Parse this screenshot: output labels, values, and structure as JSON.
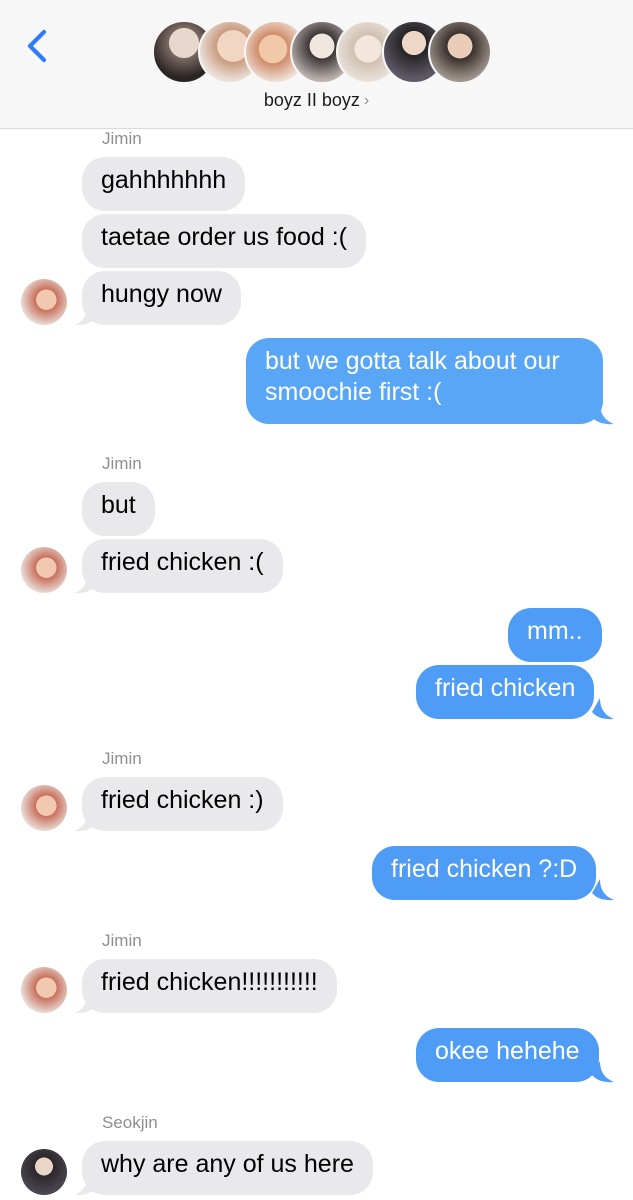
{
  "header": {
    "group_name": "boyz II boyz",
    "chevron": "›",
    "back_icon": "chevron-left-icon",
    "accent_color": "#2f7cf6",
    "member_avatar_count": 7
  },
  "colors": {
    "received_bubble": "#e9e9eb",
    "sent_bubble": "#4e9cf5",
    "sender_label": "#8e8e93"
  },
  "messages": [
    {
      "from": "Jimin",
      "direction": "received",
      "sender_label": "Jimin",
      "text": "gahhhhhhh"
    },
    {
      "from": "Jimin",
      "direction": "received",
      "text": "taetae order us food :("
    },
    {
      "from": "Jimin",
      "direction": "received",
      "text": "hungy now"
    },
    {
      "from": "me",
      "direction": "sent",
      "text_lines": [
        "but we gotta talk about our",
        "smoochie first :("
      ]
    },
    {
      "from": "Jimin",
      "direction": "received",
      "sender_label": "Jimin",
      "text": "but"
    },
    {
      "from": "Jimin",
      "direction": "received",
      "text": "fried chicken :("
    },
    {
      "from": "me",
      "direction": "sent",
      "text": "mm.."
    },
    {
      "from": "me",
      "direction": "sent",
      "text": "fried chicken"
    },
    {
      "from": "Jimin",
      "direction": "received",
      "sender_label": "Jimin",
      "text": "fried chicken :)"
    },
    {
      "from": "me",
      "direction": "sent",
      "text": "fried chicken ?:D"
    },
    {
      "from": "Jimin",
      "direction": "received",
      "sender_label": "Jimin",
      "text": "fried chicken!!!!!!!!!!!"
    },
    {
      "from": "me",
      "direction": "sent",
      "text": "okee hehehe"
    },
    {
      "from": "Seokjin",
      "direction": "received",
      "sender_label": "Seokjin",
      "text": "why are any of us here"
    }
  ]
}
